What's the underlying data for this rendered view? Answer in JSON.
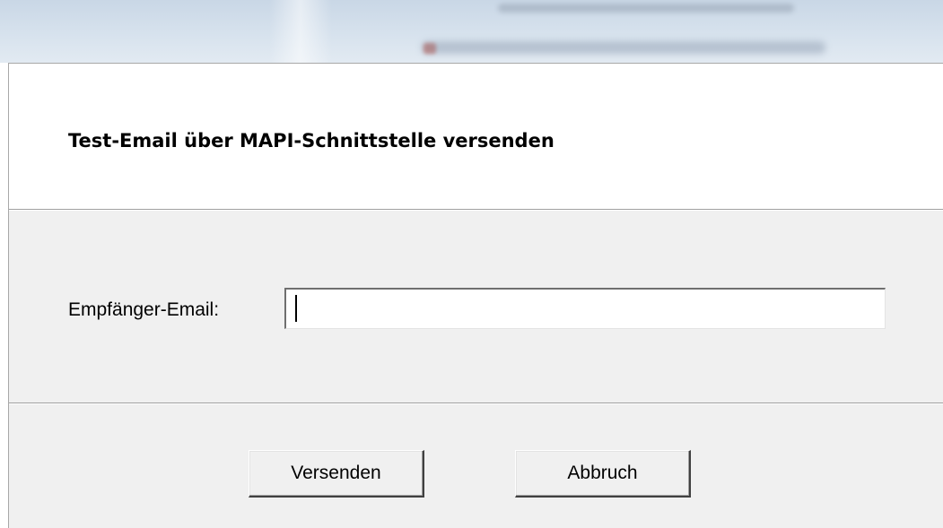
{
  "dialog": {
    "header_title": "Test-Email über MAPI-Schnittstelle versenden",
    "recipient_label": "Empfänger-Email:",
    "recipient_value": "",
    "send_button_label": "Versenden",
    "cancel_button_label": "Abbruch"
  },
  "colors": {
    "dialog_background": "#f0f0f0",
    "header_background": "#ffffff",
    "text": "#000000"
  }
}
